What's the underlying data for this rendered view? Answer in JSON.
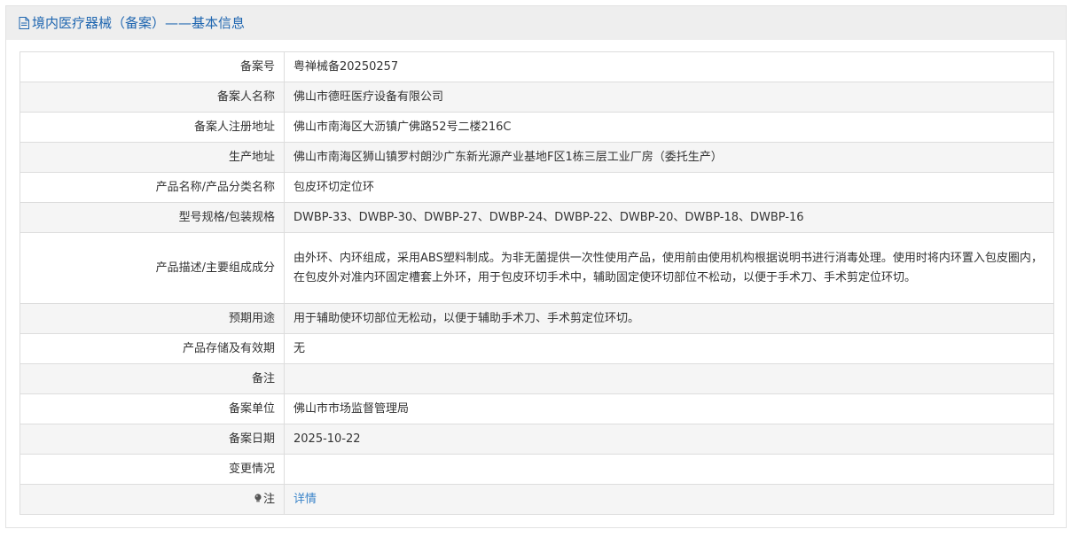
{
  "header": {
    "title": "境内医疗器械（备案）——基本信息",
    "icon": "document-icon"
  },
  "rows": [
    {
      "label": "备案号",
      "value": "粤禅械备20250257"
    },
    {
      "label": "备案人名称",
      "value": "佛山市德旺医疗设备有限公司"
    },
    {
      "label": "备案人注册地址",
      "value": "佛山市南海区大沥镇广佛路52号二楼216C"
    },
    {
      "label": "生产地址",
      "value": "佛山市南海区狮山镇罗村朗沙广东新光源产业基地F区1栋三层工业厂房（委托生产）"
    },
    {
      "label": "产品名称/产品分类名称",
      "value": "包皮环切定位环"
    },
    {
      "label": "型号规格/包装规格",
      "value": "DWBP-33、DWBP-30、DWBP-27、DWBP-24、DWBP-22、DWBP-20、DWBP-18、DWBP-16"
    },
    {
      "label": "产品描述/主要组成成分",
      "value": "由外环、内环组成，采用ABS塑料制成。为非无菌提供一次性使用产品，使用前由使用机构根据说明书进行消毒处理。使用时将内环置入包皮圈内，在包皮外对准内环固定槽套上外环，用于包皮环切手术中，辅助固定使环切部位不松动，以便于手术刀、手术剪定位环切。"
    },
    {
      "label": "预期用途",
      "value": "用于辅助使环切部位无松动，以便于辅助手术刀、手术剪定位环切。"
    },
    {
      "label": "产品存储及有效期",
      "value": "无"
    },
    {
      "label": "备注",
      "value": ""
    },
    {
      "label": "备案单位",
      "value": "佛山市市场监督管理局"
    },
    {
      "label": "备案日期",
      "value": "2025-10-22"
    },
    {
      "label": "变更情况",
      "value": ""
    }
  ],
  "note": {
    "label": "注",
    "icon": "lightbulb-icon",
    "link_text": "详情"
  },
  "colors": {
    "title": "#1f66b0",
    "header_bg": "#eeeeee",
    "stripe": "#f5f5f5",
    "border": "#dddddd",
    "link": "#3a84c9"
  }
}
